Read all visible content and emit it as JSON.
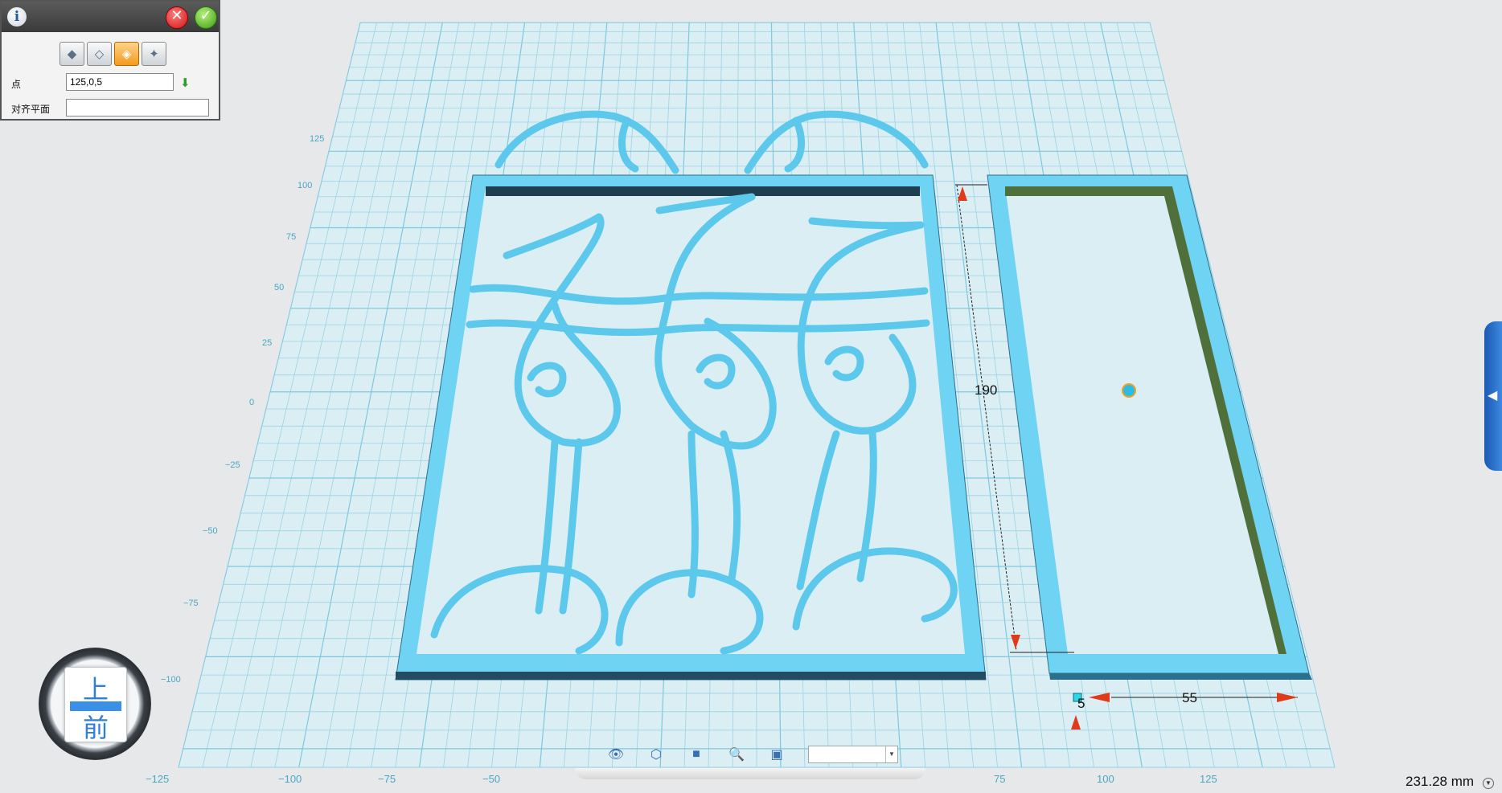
{
  "panel": {
    "title_icon": "info-icon",
    "close_icon": "close-icon",
    "confirm_icon": "check-icon",
    "modes": [
      "surface-mode-1",
      "surface-mode-2",
      "surface-mode-3",
      "surface-mode-4"
    ],
    "active_mode_index": 2,
    "point_label": "点",
    "point_value": "125,0,5",
    "align_plane_label": "对齐平面",
    "align_plane_value": ""
  },
  "view_cube": {
    "top": "上",
    "front": "前"
  },
  "grid": {
    "x_ticks": [
      "−125",
      "−100",
      "−75",
      "−50",
      "75",
      "100",
      "125"
    ],
    "y_ticks": [
      "125",
      "100",
      "75",
      "50",
      "25",
      "0",
      "−25",
      "−50",
      "−75",
      "−100"
    ]
  },
  "dimensions": {
    "height": "190",
    "width": "55",
    "thickness": "5"
  },
  "toolbar": {
    "icons": [
      "eye-icon",
      "cube-wire-icon",
      "cube-solid-icon",
      "zoom-icon",
      "fit-view-icon"
    ],
    "select_value": ""
  },
  "status": {
    "measurement": "231.28 mm"
  },
  "colors": {
    "model": "#75d6f5",
    "model_dark": "#2a6f8c",
    "grid_bg": "#d9eef4",
    "grid_line": "#96d3e4",
    "inner_edge": "#4f6f3b"
  }
}
